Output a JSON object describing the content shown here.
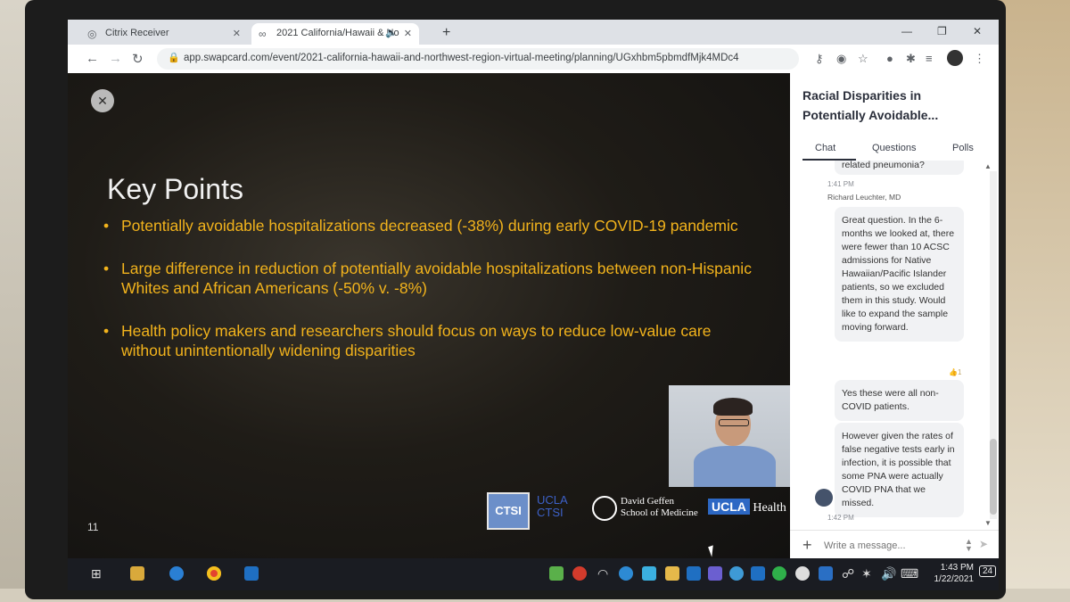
{
  "browser": {
    "tabs": [
      {
        "title": "Citrix Receiver"
      },
      {
        "title": "2021 California/Hawaii & No"
      }
    ],
    "new_tab_symbol": "+",
    "url": "app.swapcard.com/event/2021-california-hawaii-and-northwest-region-virtual-meeting/planning/UGxhbm5pbmdfMjk4MDc4"
  },
  "slide": {
    "title": "Key Points",
    "bullets": [
      "Potentially avoidable hospitalizations decreased (-38%) during early COVID-19 pandemic",
      "Large difference in reduction of potentially avoidable hospitalizations between non-Hispanic Whites and African Americans (-50% v. -8%)",
      "Health policy makers and researchers should focus on ways to reduce low-value care without unintentionally widening disparities"
    ],
    "slide_number": "11",
    "logos": {
      "ctsi_box": "CTSI",
      "ucla_ctsi_line1": "UCLA",
      "ucla_ctsi_line2": "CTSI",
      "geffen_line1": "David Geffen",
      "geffen_line2": "School of Medicine",
      "health_ucla": "UCLA",
      "health_word": "Health"
    }
  },
  "panel": {
    "title": "Racial Disparities in Potentially Avoidable...",
    "tabs": [
      "Chat",
      "Questions",
      "Polls"
    ],
    "messages": [
      {
        "text": "related pneumonia?",
        "time": "1:41 PM"
      },
      {
        "sender": "Richard Leuchter, MD",
        "text": "Great question. In the 6-months we looked at, there were fewer than 10 ACSC admissions for Native Hawaiian/Pacific Islander patients, so we excluded them in this study. Would like to expand the sample moving forward.",
        "reaction": "1"
      },
      {
        "text": "Yes these were all non-COVID patients."
      },
      {
        "text": "However given the rates of false negative tests early in infection, it is possible that some PNA were actually COVID PNA that we missed.",
        "time": "1:42 PM"
      }
    ],
    "composer_placeholder": "Write a message..."
  },
  "taskbar": {
    "time": "1:43 PM",
    "date": "1/22/2021",
    "notifications": "24"
  }
}
